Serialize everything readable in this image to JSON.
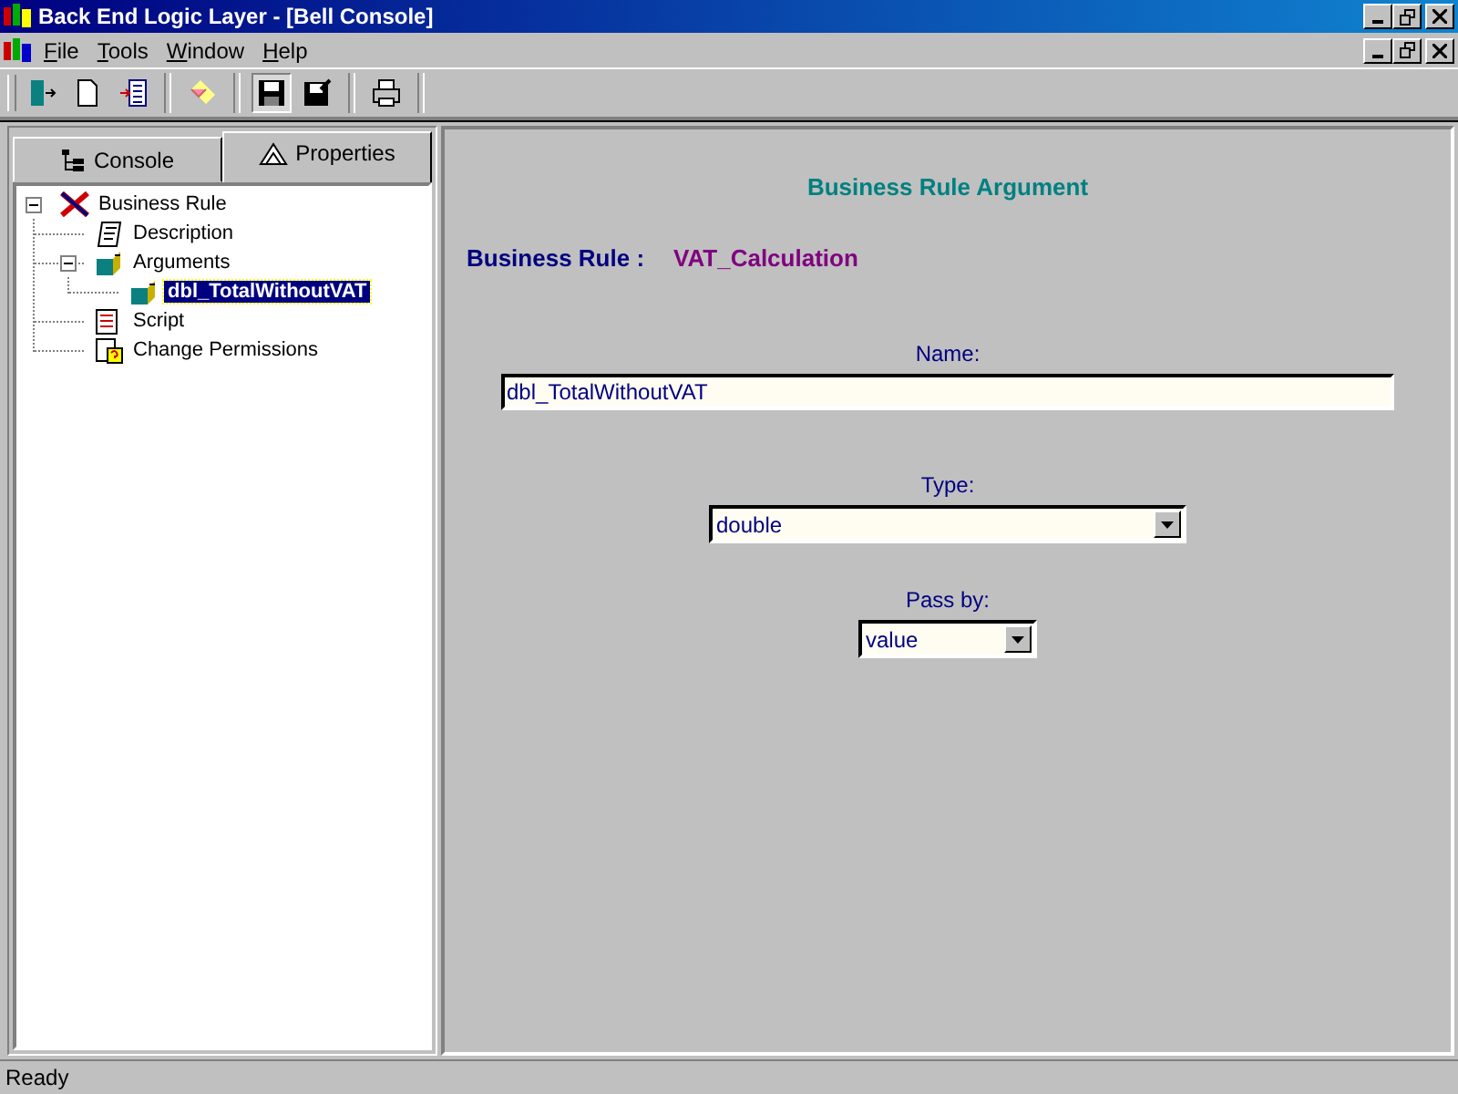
{
  "window": {
    "title": "Back End Logic Layer - [Bell Console]"
  },
  "menu": [
    {
      "label": "File"
    },
    {
      "label": "Tools"
    },
    {
      "label": "Window"
    },
    {
      "label": "Help"
    }
  ],
  "tabs": [
    {
      "label": "Console",
      "selected": false
    },
    {
      "label": "Properties",
      "selected": true
    }
  ],
  "tree": [
    {
      "label": "Business Rule",
      "kind": "rule",
      "selected": false,
      "expanded": true,
      "children": [
        {
          "label": "Description",
          "kind": "description",
          "selected": false
        },
        {
          "label": "Arguments",
          "kind": "arguments",
          "selected": false,
          "expanded": true,
          "children": [
            {
              "label": "dbl_TotalWithoutVAT",
              "kind": "argument",
              "selected": true
            }
          ]
        },
        {
          "label": "Script",
          "kind": "script",
          "selected": false
        },
        {
          "label": "Change Permissions",
          "kind": "permissions",
          "selected": false
        }
      ]
    }
  ],
  "form": {
    "heading": "Business Rule Argument",
    "rule_label": "Business Rule :",
    "rule_value": "VAT_Calculation",
    "name_label": "Name:",
    "name_value": "dbl_TotalWithoutVAT",
    "type_label": "Type:",
    "type_value": "double",
    "pass_label": "Pass by:",
    "pass_value": "value"
  },
  "status_bar": {
    "text": "Ready"
  }
}
